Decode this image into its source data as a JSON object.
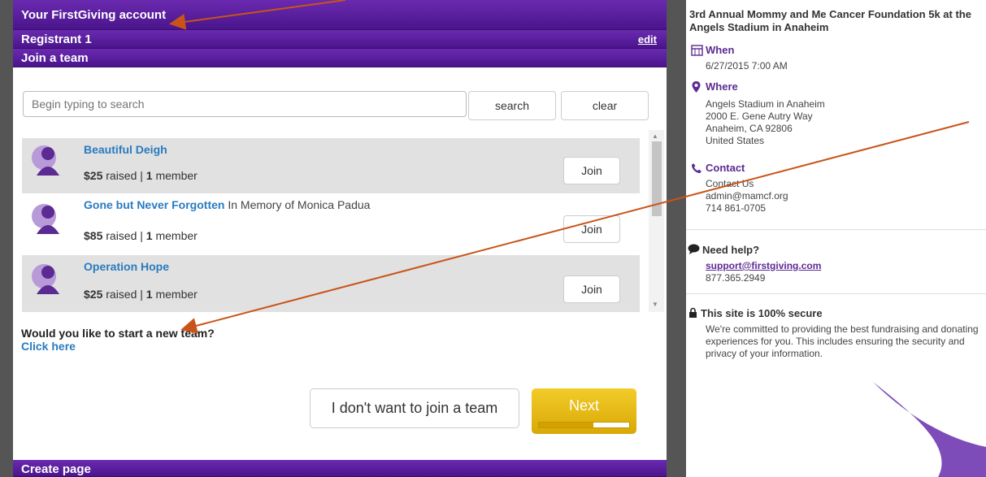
{
  "colors": {
    "brand_purple": "#5b2a92",
    "link_blue": "#2a7bc0",
    "next_yellow": "#e8bb10",
    "arrow_red": "#c9541a"
  },
  "left": {
    "account_header": "Your FirstGiving account",
    "registrant_header": "Registrant 1",
    "edit_label": "edit",
    "join_header": "Join a team",
    "search": {
      "placeholder": "Begin typing to search",
      "value": "",
      "search_label": "search",
      "clear_label": "clear"
    },
    "teams": [
      {
        "name": "Beautiful Deigh",
        "memory": "",
        "raised": "$25",
        "raised_suffix": " raised | ",
        "members": "1",
        "members_suffix": " member",
        "join_label": "Join",
        "avatar": "team-avatar-icon"
      },
      {
        "name": "Gone but Never Forgotten",
        "memory": " In Memory of Monica Padua",
        "raised": "$85",
        "raised_suffix": " raised | ",
        "members": "1",
        "members_suffix": " member",
        "join_label": "Join",
        "avatar": "team-avatar-icon"
      },
      {
        "name": "Operation Hope",
        "memory": "",
        "raised": "$25",
        "raised_suffix": " raised | ",
        "members": "1",
        "members_suffix": " member",
        "join_label": "Join",
        "avatar": "team-avatar-icon"
      }
    ],
    "new_team_prompt": "Would you like to start a new team?",
    "click_here": "Click here",
    "no_team_label": "I don't want to join a team",
    "next_label": "Next",
    "progress": 0.6,
    "create_header": "Create page"
  },
  "right": {
    "event_title": "3rd Annual Mommy and Me Cancer Foundation 5k at the Angels Stadium in Anaheim",
    "when_label": "When",
    "when_value": "6/27/2015 7:00 AM",
    "where_label": "Where",
    "where_lines": [
      "Angels Stadium in Anaheim",
      "2000 E. Gene Autry Way",
      "Anaheim, CA 92806",
      "United States"
    ],
    "contact_label": "Contact",
    "contact_lines": [
      "Contact Us",
      "admin@mamcf.org",
      "714 861-0705"
    ],
    "help_label": "Need help?",
    "help_email": "support@firstgiving.com",
    "help_phone": "877.365.2949",
    "secure_label": "This site is 100% secure",
    "secure_text": "We're committed to providing the best fundraising and donating experiences for you. This includes ensuring the security and privacy of your information."
  }
}
